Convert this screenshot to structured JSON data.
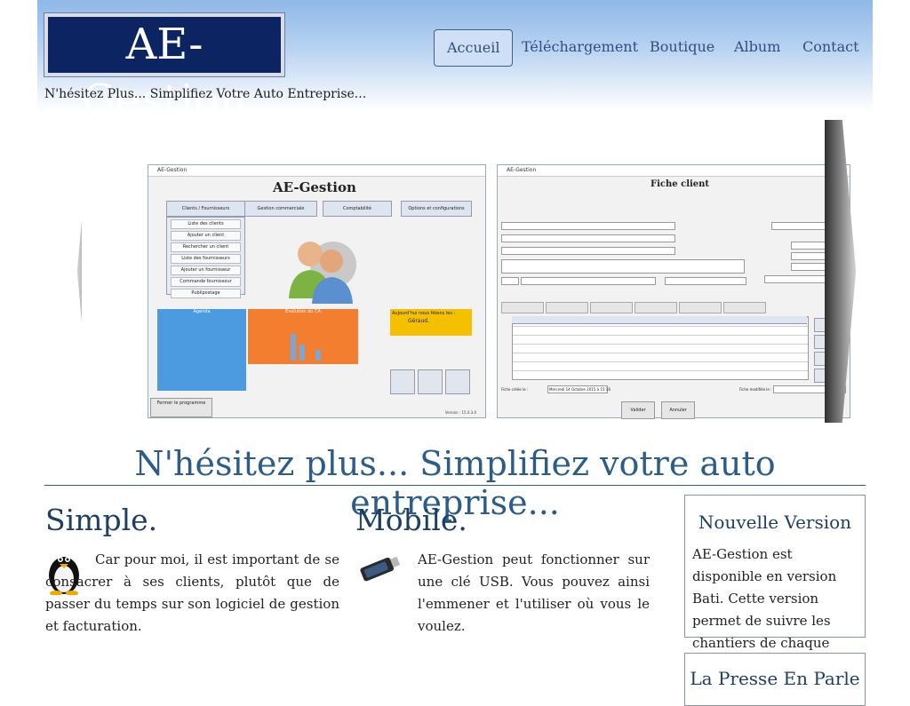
{
  "brand": {
    "logo": "AE-Gestion",
    "tagline": "N'hésitez Plus... Simplifiez Votre Auto Entreprise..."
  },
  "nav": {
    "items": [
      "Accueil",
      "Téléchargement",
      "Boutique",
      "Album",
      "Contact"
    ],
    "active": "Accueil"
  },
  "slide": {
    "left_window": {
      "titlebar": "AE-Gestion",
      "app_title": "AE-Gestion",
      "tabs": [
        "Clients / Fournisseurs",
        "Gestion commerciale",
        "Comptabilité",
        "Options et configurations"
      ],
      "menu_items": [
        "Liste des clients",
        "Ajouter un client",
        "Rechercher un client",
        "Liste des fournisseurs",
        "Ajouter un fournisseur",
        "Commande fournisseur",
        "Publipostage"
      ],
      "panel_agenda": "Agenda",
      "panel_ca": "Evolution du CA",
      "panel_birthday": "Aujourd'hui nous fêtons les :",
      "birthday_name": "Géraud.",
      "close_button": "Fermer le programme",
      "version": "Version : 15.0.3.0"
    },
    "right_window": {
      "titlebar": "AE-Gestion",
      "form_title": "Fiche client",
      "tabs": [
        "Contacts",
        "Observations",
        "Suivi",
        "Rendez-vous",
        "Documents de vente",
        "Parrainage"
      ],
      "buttons": [
        "Valider",
        "Annuler"
      ],
      "created_label": "Fiche créée le :",
      "created_value": "Mercredi 14 Octobre 2015 à 15:16",
      "modified_label": "Fiche modifiée le :"
    }
  },
  "headline": "N'hésitez plus... Simplifiez votre auto entreprise...",
  "simple": {
    "title": "Simple.",
    "text": "Car pour moi, il est important de se consacrer à ses clients, plutôt que de passer du temps sur son logiciel de gestion et facturation."
  },
  "mobile": {
    "title": "Mobile.",
    "text": "AE-Gestion peut fonctionner sur une clé USB. Vous pouvez ainsi l'emmener et l'utiliser où vous le voulez."
  },
  "news": {
    "title": "Nouvelle Version",
    "text": "AE-Gestion est disponible en version Bati. Cette version permet de suivre les chantiers de chaque client."
  },
  "press": {
    "title": "La Presse En Parle"
  },
  "colors": {
    "logo_bg": "#0c2461",
    "heading": "#2c5d8a",
    "nav_text": "#2e4f7a"
  }
}
